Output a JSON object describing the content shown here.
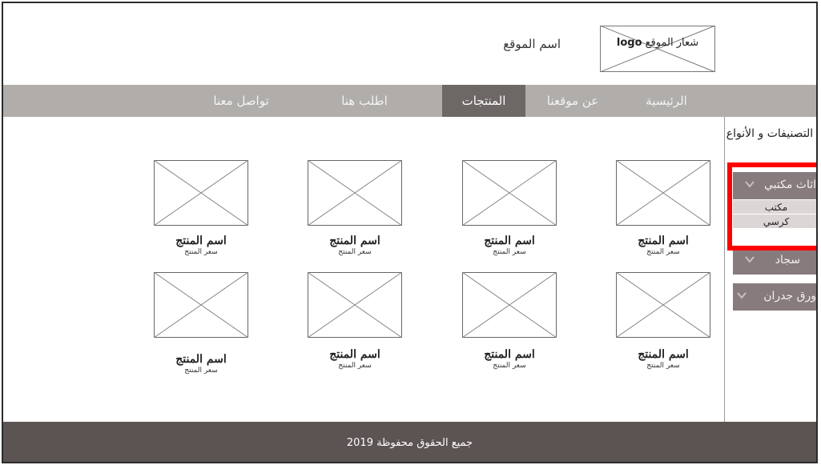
{
  "header": {
    "site_name": "اسم الموقع",
    "logo_label": "شعار الموقع",
    "logo_word": "logo"
  },
  "nav": {
    "items": [
      {
        "label": "الرئيسية",
        "active": false
      },
      {
        "label": "عن موقعنا",
        "active": false
      },
      {
        "label": "المنتجات",
        "active": true
      },
      {
        "label": "اطلب هنا",
        "active": false
      },
      {
        "label": "تواصل معنا",
        "active": false
      }
    ]
  },
  "sidebar": {
    "title": "التصنيفات و الأنواع",
    "categories": [
      {
        "label": "اثاث مكتبي",
        "expanded": true,
        "sub": [
          "مكتب",
          "كرسي"
        ]
      },
      {
        "label": "سجاد",
        "expanded": false
      },
      {
        "label": "ورق جدران",
        "expanded": false
      }
    ],
    "chevron_icon": "chevron-down-icon"
  },
  "products": [
    {
      "name": "اسم المنتج",
      "price": "سعر المنتج"
    },
    {
      "name": "اسم المنتج",
      "price": "سعر المنتج"
    },
    {
      "name": "اسم المنتج",
      "price": "سعر المنتج"
    },
    {
      "name": "اسم المنتج",
      "price": "سعر المنتج"
    },
    {
      "name": "اسم المنتج",
      "price": "سعر المنتج"
    },
    {
      "name": "اسم المنتج",
      "price": "سعر المنتج"
    },
    {
      "name": "اسم المنتج",
      "price": "سعر المنتج"
    },
    {
      "name": "اسم المنتج",
      "price": "سعر المنتج"
    }
  ],
  "footer": {
    "copyright": "جميع الحقوق محفوظة 2019"
  },
  "colors": {
    "nav_bg": "#b0adaa",
    "nav_active": "#6d6866",
    "category_bg": "#877b7e",
    "footer_bg": "#5b5453",
    "highlight": "#ff0000"
  }
}
